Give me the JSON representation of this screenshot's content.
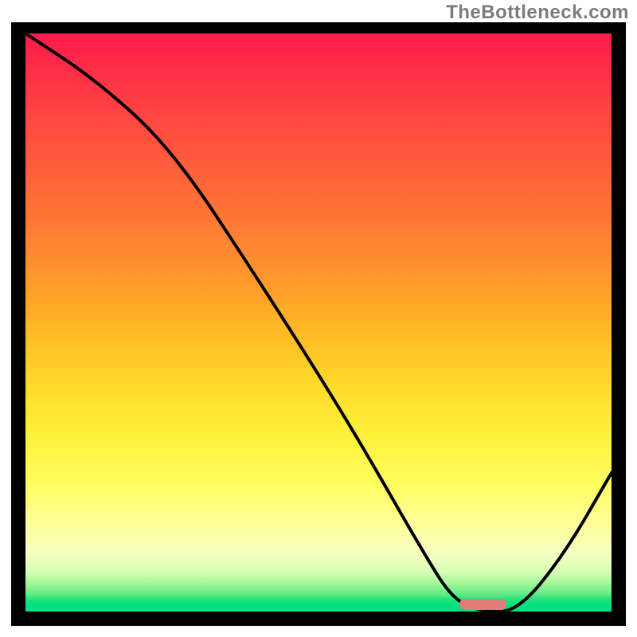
{
  "watermark": "TheBottleneck.com",
  "chart_data": {
    "type": "line",
    "title": "",
    "xlabel": "",
    "ylabel": "",
    "xlim": [
      0,
      100
    ],
    "ylim": [
      0,
      100
    ],
    "grid": false,
    "legend": false,
    "background": "rainbow-heatmap",
    "gradient_stops": [
      {
        "pos": 0,
        "color": "#ff1a4a"
      },
      {
        "pos": 13,
        "color": "#ff4243"
      },
      {
        "pos": 33,
        "color": "#ff7a33"
      },
      {
        "pos": 52,
        "color": "#ffbb25"
      },
      {
        "pos": 70,
        "color": "#fff23b"
      },
      {
        "pos": 85,
        "color": "#feff9a"
      },
      {
        "pos": 95,
        "color": "#a6f99a"
      },
      {
        "pos": 100,
        "color": "#00df82"
      }
    ],
    "series": [
      {
        "name": "bottleneck-curve",
        "color": "#000000",
        "x": [
          0,
          12,
          25,
          40,
          55,
          68,
          73,
          78,
          84,
          92,
          100
        ],
        "values": [
          100,
          92,
          80,
          57,
          33,
          10,
          2,
          0,
          0,
          10,
          24
        ]
      }
    ],
    "marker": {
      "name": "optimal-range",
      "color": "#e37b78",
      "shape": "rounded-bar",
      "x_start": 74,
      "x_end": 82,
      "y": 0
    }
  }
}
